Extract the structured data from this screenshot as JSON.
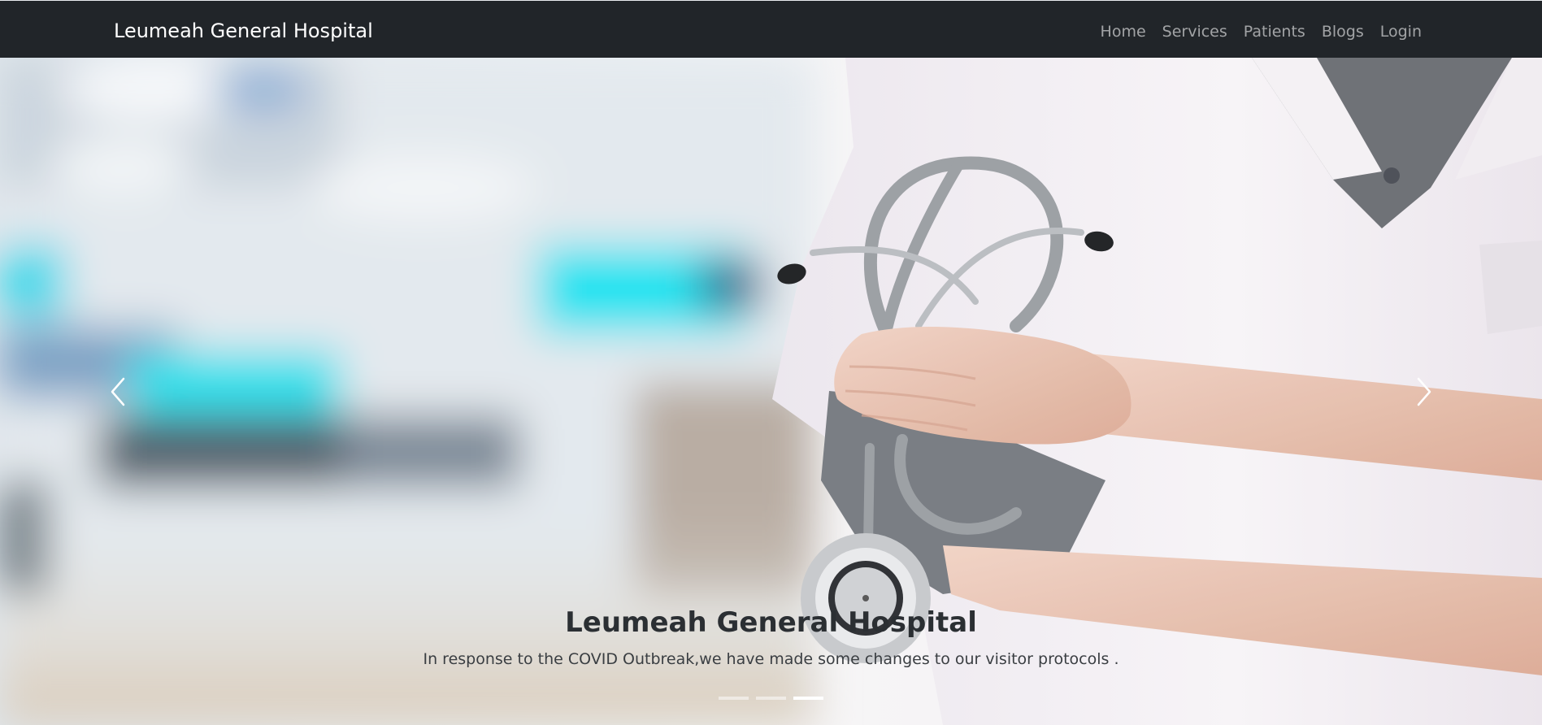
{
  "navbar": {
    "brand": "Leumeah General Hospital",
    "links": [
      {
        "label": "Home"
      },
      {
        "label": "Services"
      },
      {
        "label": "Patients"
      },
      {
        "label": "Blogs"
      },
      {
        "label": "Login"
      }
    ]
  },
  "carousel": {
    "caption_title": "Leumeah General Hospital",
    "caption_text": "In response to the COVID Outbreak,we have made some changes to our visitor protocols .",
    "prev_icon": "chevron-left-icon",
    "next_icon": "chevron-right-icon",
    "indicators": 3,
    "active_indicator": 2
  },
  "colors": {
    "navbar_bg": "#212529",
    "brand": "#ffffff",
    "nav_link": "rgba(255,255,255,0.58)",
    "caption": "#2b2f33"
  }
}
